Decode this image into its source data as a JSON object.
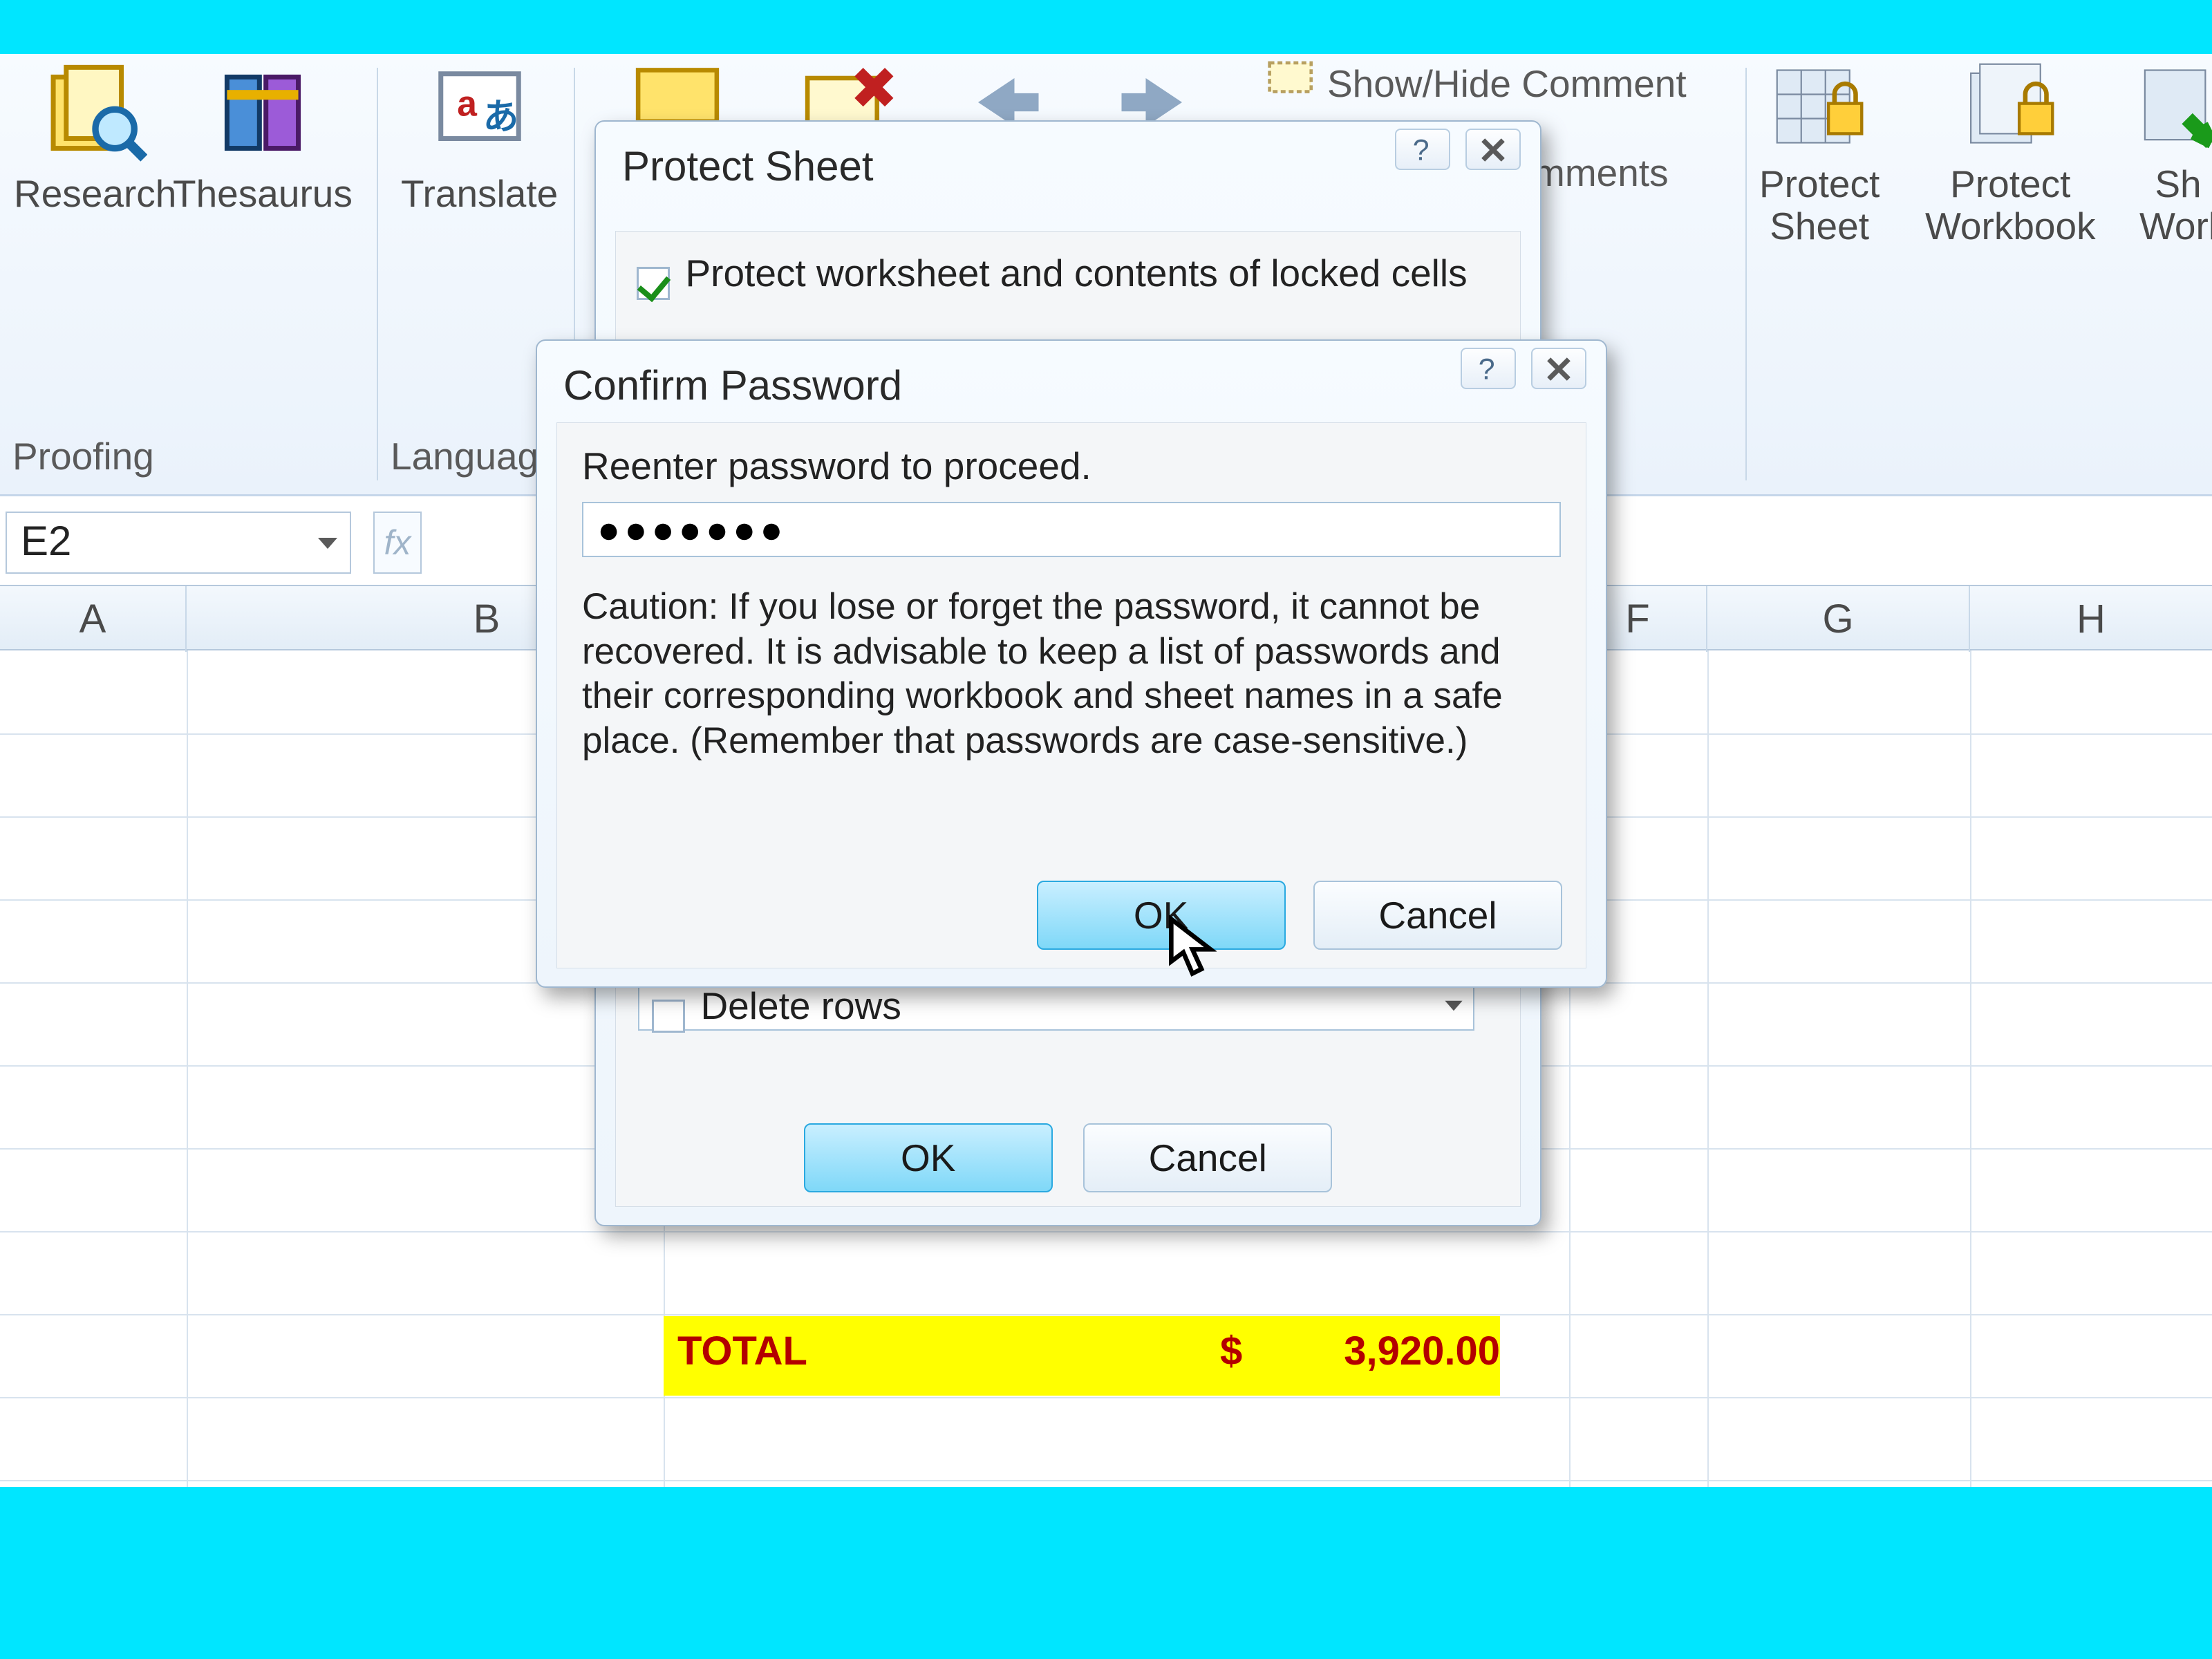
{
  "ribbon": {
    "research": "Research",
    "thesaurus": "Thesaurus",
    "translate": "Translate",
    "showhide": "Show/Hide Comment",
    "comments_cut": "mments",
    "protect_sheet": "Protect\nSheet",
    "protect_workbook": "Protect\nWorkbook",
    "share_cut": "Sh\nWorl",
    "group_proofing": "Proofing",
    "group_language": "Language"
  },
  "namebox": {
    "ref": "E2"
  },
  "columns": {
    "A": "A",
    "B": "B",
    "F": "F",
    "G": "G",
    "H": "H"
  },
  "sheetdata": {
    "total_label": "TOTAL",
    "total_currency": "$",
    "total_value": "3,920.00"
  },
  "dlg_protect": {
    "title": "Protect Sheet",
    "chk1_label": "Protect worksheet and contents of locked cells",
    "delete_rows": "Delete rows",
    "ok": "OK",
    "cancel": "Cancel"
  },
  "dlg_confirm": {
    "title": "Confirm Password",
    "prompt": "Reenter password to proceed.",
    "password": "●●●●●●●",
    "caution": "Caution: If you lose or forget the password, it cannot be recovered. It is advisable to keep a list of passwords and their corresponding workbook and sheet names in a safe place.  (Remember that passwords are case-sensitive.)",
    "ok": "OK",
    "cancel": "Cancel"
  }
}
